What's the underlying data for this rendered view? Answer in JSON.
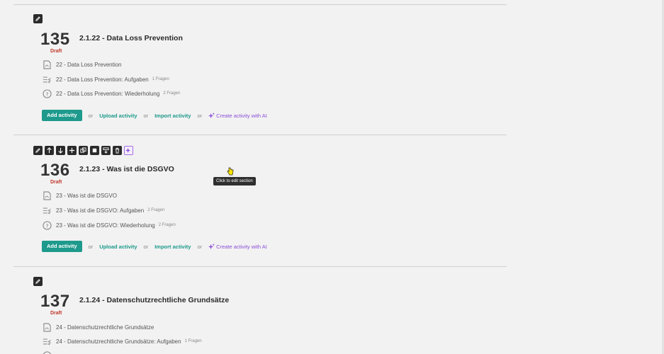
{
  "sections": [
    {
      "number": "135",
      "status": "Draft",
      "title": "2.1.22 - Data Loss Prevention",
      "activities": [
        {
          "icon": "pdf-icon",
          "label": "22 - Data Loss Prevention",
          "count": ""
        },
        {
          "icon": "checklist-icon",
          "label": "22 - Data Loss Prevention: Aufgaben",
          "count": "1 Fragen"
        },
        {
          "icon": "question-circle-icon",
          "label": "22 - Data Loss Prevention: Wiederholung",
          "count": "2 Fragen"
        }
      ]
    },
    {
      "number": "136",
      "status": "Draft",
      "title": "2.1.23 - Was ist die DSGVO",
      "activities": [
        {
          "icon": "pdf-icon",
          "label": "23 - Was ist die DSGVO",
          "count": ""
        },
        {
          "icon": "checklist-icon",
          "label": "23 - Was ist die DSGVO: Aufgaben",
          "count": "2 Fragen"
        },
        {
          "icon": "question-circle-icon",
          "label": "23 - Was ist die DSGVO: Wiederholung",
          "count": "2 Fragen"
        }
      ]
    },
    {
      "number": "137",
      "status": "Draft",
      "title": "2.1.24 - Datenschutzrechtliche Grundsätze",
      "activities": [
        {
          "icon": "pdf-icon",
          "label": "24 - Datenschutzrechtliche Grundsätze",
          "count": ""
        },
        {
          "icon": "checklist-icon",
          "label": "24 - Datenschutzrechtliche Grundsätze: Aufgaben",
          "count": "1 Fragen"
        }
      ]
    }
  ],
  "actions": {
    "add": "Add activity",
    "or": "or",
    "upload": "Upload activity",
    "import": "Import activity",
    "create_ai": "Create activity with AI"
  },
  "tooltip": "Click to edit section",
  "colors": {
    "accent": "#1d9a8c",
    "draft": "#c0392b",
    "ai": "#8a4fd8"
  }
}
